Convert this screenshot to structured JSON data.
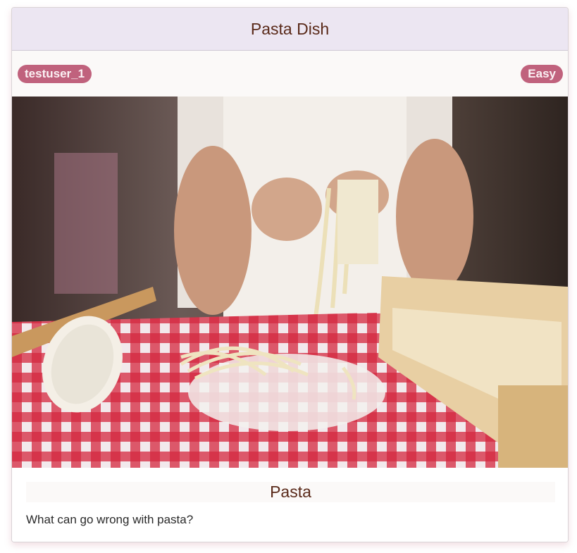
{
  "card": {
    "title": "Pasta Dish",
    "author": "testuser_1",
    "difficulty": "Easy",
    "image_alt": "Person making fresh pasta on a red checkered tablecloth",
    "dish_name": "Pasta",
    "description": "What can go wrong with pasta?"
  },
  "colors": {
    "header_bg": "#ece6f2",
    "badge_bg": "#c0627d",
    "title_text": "#5a2a1a"
  }
}
